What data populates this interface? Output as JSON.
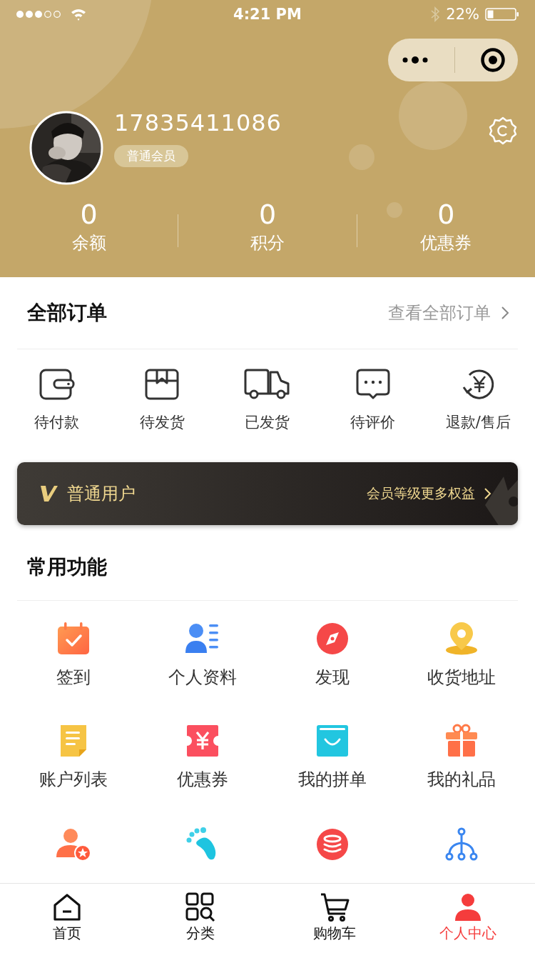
{
  "status_bar": {
    "time": "4:21 PM",
    "battery": "22%"
  },
  "profile": {
    "phone": "17835411086",
    "member_level": "普通会员"
  },
  "stats": [
    {
      "value": "0",
      "label": "余额"
    },
    {
      "value": "0",
      "label": "积分"
    },
    {
      "value": "0",
      "label": "优惠券"
    }
  ],
  "orders": {
    "title": "全部订单",
    "view_all": "查看全部订单",
    "items": [
      "待付款",
      "待发货",
      "已发货",
      "待评价",
      "退款/售后"
    ]
  },
  "vip_banner": {
    "level": "普通用户",
    "link": "会员等级更多权益"
  },
  "functions": {
    "title": "常用功能",
    "items": [
      "签到",
      "个人资料",
      "发现",
      "收货地址",
      "账户列表",
      "优惠券",
      "我的拼单",
      "我的礼品"
    ]
  },
  "tab_bar": [
    {
      "label": "首页",
      "selected": false
    },
    {
      "label": "分类",
      "selected": false
    },
    {
      "label": "购物车",
      "selected": false
    },
    {
      "label": "个人中心",
      "selected": true
    }
  ]
}
